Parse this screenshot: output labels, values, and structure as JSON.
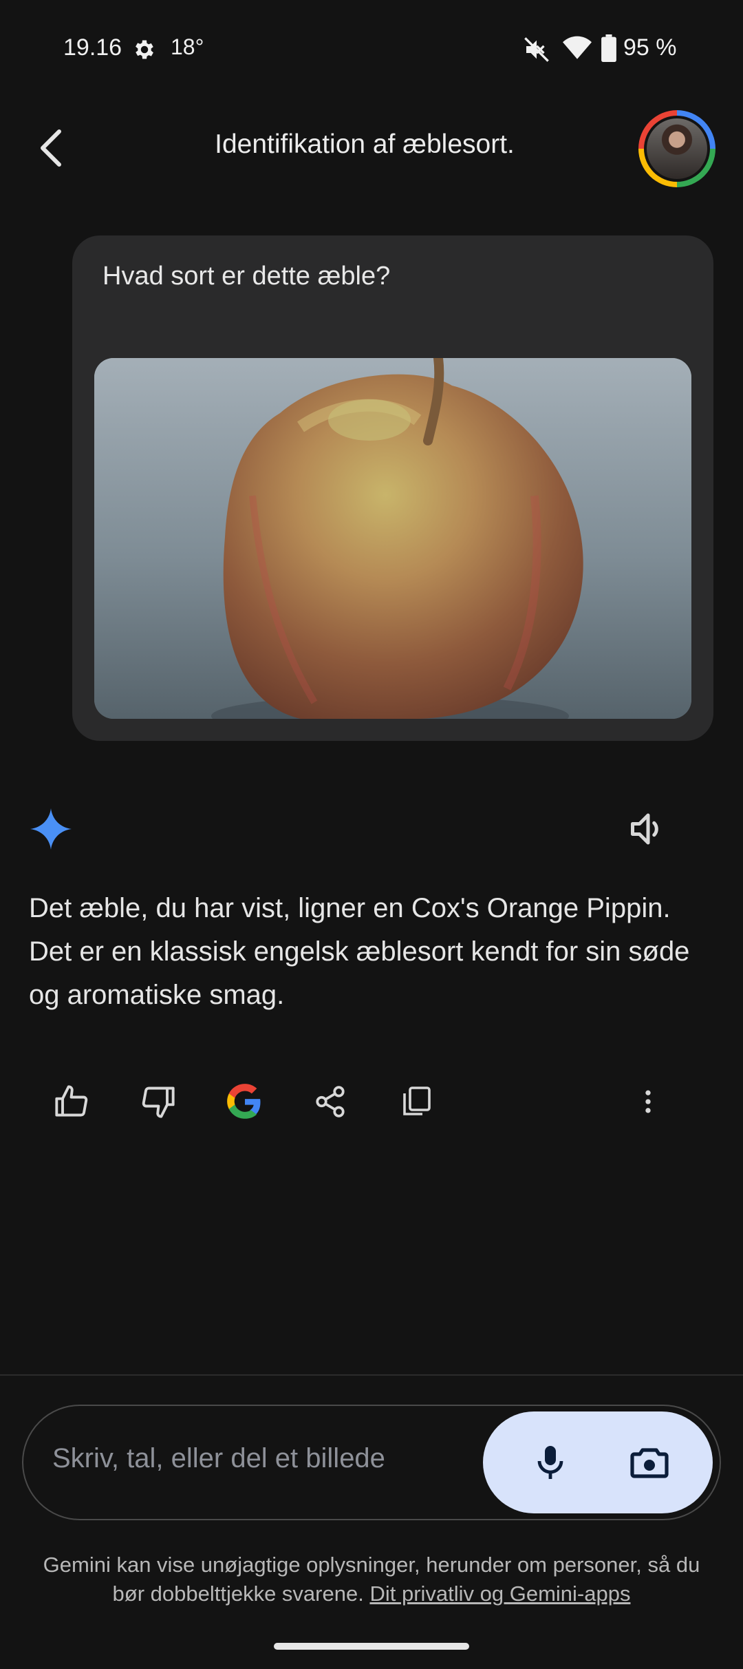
{
  "status_bar": {
    "time": "19.16",
    "temperature": "18°",
    "battery": "95 %",
    "icons": [
      "gear-icon",
      "mute-icon",
      "wifi-icon",
      "battery-icon"
    ]
  },
  "header": {
    "title": "Identifikation af æblesort.",
    "back_icon": "chevron-left-icon",
    "avatar": "user-avatar"
  },
  "user_message": {
    "text": "Hvad sort er dette æble?",
    "image": "apple-photo"
  },
  "response": {
    "text": "Det æble, du har vist, ligner en Cox's Orange Pippin. Det er en klassisk engelsk æblesort kendt for sin søde og aromatiske smag.",
    "actions": [
      "thumbs-up-icon",
      "thumbs-down-icon",
      "google-icon",
      "share-icon",
      "copy-icon",
      "more-vert-icon"
    ]
  },
  "input": {
    "placeholder": "Skriv, tal, eller del et billede"
  },
  "disclaimer": {
    "text": "Gemini kan vise unøjagtige oplysninger, herunder om personer, så du bør dobbelttjekke svarene. ",
    "link": "Dit privatliv og Gemini-apps"
  },
  "colors": {
    "background": "#131313",
    "card": "#2a2a2b",
    "input_actions_bg": "#d8e3fb",
    "accent_blue": "#4285f4"
  }
}
